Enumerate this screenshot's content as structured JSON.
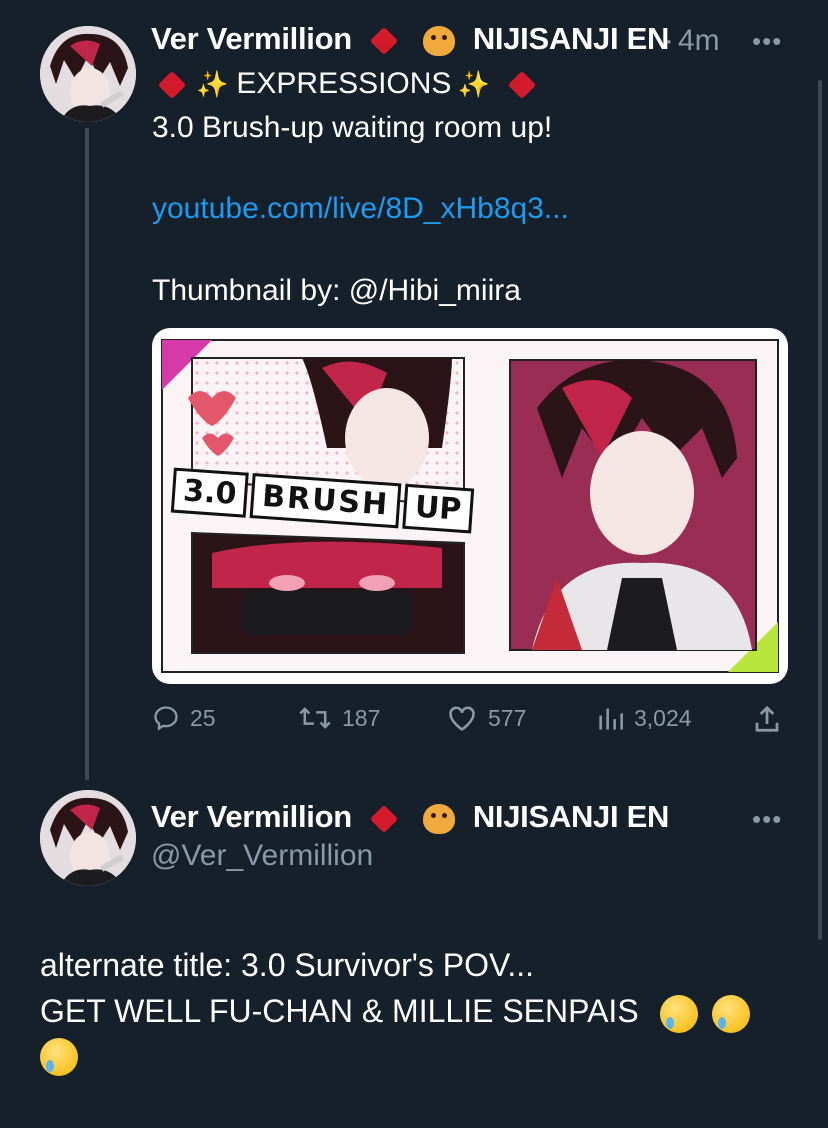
{
  "tweet1": {
    "author_name": "Ver Vermillion",
    "affiliation": "NIJISANJI EN",
    "separator": "·",
    "time": "4m",
    "more": "•••",
    "title_line": "EXPRESSIONS",
    "line2": "3.0 Brush-up waiting room up!",
    "link": "youtube.com/live/8D_xHb8q3...",
    "credit": "Thumbnail by: @/Hibi_miira",
    "media_text": {
      "part1": "3.0",
      "part2": "BRUSH",
      "part3": "UP"
    },
    "stats": {
      "replies": "25",
      "retweets": "187",
      "likes": "577",
      "views": "3,024"
    }
  },
  "tweet2": {
    "author_name": "Ver Vermillion",
    "affiliation": "NIJISANJI EN",
    "handle": "@Ver_Vermillion",
    "more": "•••",
    "line1": "alternate title: 3.0 Survivor's POV...",
    "line2": "GET WELL FU-CHAN & MILLIE SENPAIS"
  },
  "colors": {
    "background": "#15202b",
    "muted": "#8b98a5",
    "link": "#1d9bf0",
    "diamond": "#d41b2c"
  },
  "icons": [
    "reply-icon",
    "retweet-icon",
    "like-icon",
    "views-icon",
    "share-icon",
    "diamond-icon",
    "tiger-icon",
    "sparkles-icon",
    "crying-face-icon"
  ]
}
